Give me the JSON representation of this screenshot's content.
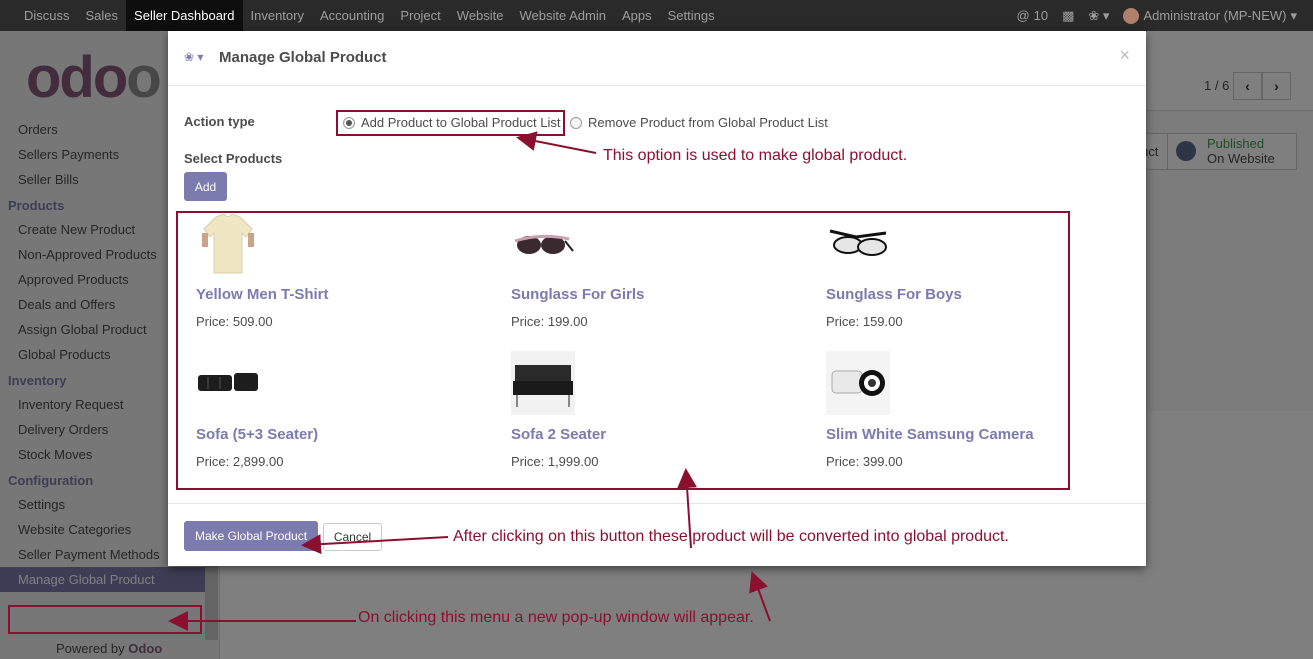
{
  "topbar": {
    "menu": [
      "Discuss",
      "Sales",
      "Seller Dashboard",
      "Inventory",
      "Accounting",
      "Project",
      "Website",
      "Website Admin",
      "Apps",
      "Settings"
    ],
    "active": "Seller Dashboard",
    "mentions_count": "10",
    "user": "Administrator (MP-NEW)"
  },
  "sidebar": {
    "logo_text": "odoo",
    "items_top": [
      "Orders",
      "Sellers Payments",
      "Seller Bills"
    ],
    "products_header": "Products",
    "products_items": [
      "Create New Product",
      "Non-Approved Products",
      "Approved Products",
      "Deals and Offers",
      "Assign Global Product",
      "Global Products"
    ],
    "inventory_header": "Inventory",
    "inventory_items": [
      "Inventory Request",
      "Delivery Orders",
      "Stock Moves"
    ],
    "config_header": "Configuration",
    "config_items": [
      "Settings",
      "Website Categories",
      "Seller Payment Methods",
      "Manage Global Product"
    ],
    "powered_by": "Powered by",
    "powered_brand": "Odoo"
  },
  "background": {
    "pager": "1 / 6",
    "published_line1": "Published",
    "published_line2": "On Website",
    "partial_button": "uct"
  },
  "modal": {
    "title": "Manage Global Product",
    "action_type_label": "Action type",
    "option_add": "Add Product to Global Product List",
    "option_remove": "Remove Product from Global Product List",
    "select_products_label": "Select Products",
    "add_button": "Add",
    "products": [
      {
        "name": "Yellow Men T-Shirt",
        "price": "Price: 509.00"
      },
      {
        "name": "Sunglass For Girls",
        "price": "Price: 199.00"
      },
      {
        "name": "Sunglass For Boys",
        "price": "Price: 159.00"
      },
      {
        "name": "Sofa (5+3 Seater)",
        "price": "Price: 2,899.00"
      },
      {
        "name": "Sofa 2 Seater",
        "price": "Price: 1,999.00"
      },
      {
        "name": "Slim White Samsung Camera",
        "price": "Price: 399.00"
      }
    ],
    "primary_button": "Make Global Product",
    "cancel_button": "Cancel"
  },
  "annotations": {
    "option_note": "This option is used to make global product.",
    "button_note": "After clicking on this button these  product will be converted into global product.",
    "menu_note": "On clicking this menu a new pop-up window will appear."
  },
  "colors": {
    "accent": "#7c7bad",
    "annotation": "#8b1030",
    "brand": "#875a7b"
  }
}
